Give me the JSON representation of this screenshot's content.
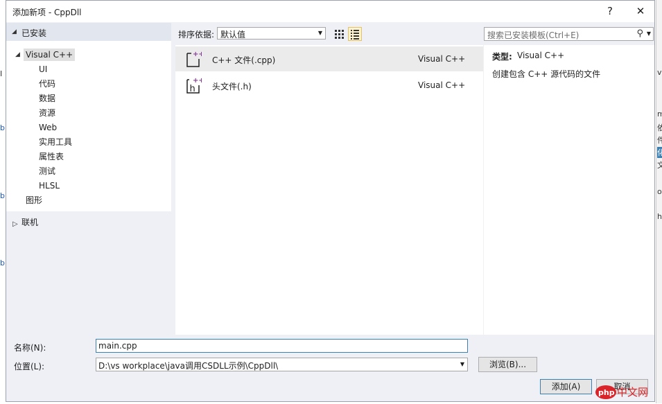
{
  "window": {
    "title": "添加新项 - CppDll",
    "help_label": "?",
    "close_label": "✕"
  },
  "left": {
    "installed_label": "已安装",
    "root_label": "Visual C++",
    "children": [
      "UI",
      "代码",
      "数据",
      "资源",
      "Web",
      "实用工具",
      "属性表",
      "测试",
      "HLSL"
    ],
    "graphics_label": "图形",
    "online_label": "联机"
  },
  "sort": {
    "label": "排序依据:",
    "value": "默认值"
  },
  "files": [
    {
      "name": "C++ 文件(.cpp)",
      "lang": "Visual C++",
      "icon": "cpp-file-icon",
      "selected": true
    },
    {
      "name": "头文件(.h)",
      "lang": "Visual C++",
      "icon": "header-file-icon",
      "selected": false
    }
  ],
  "search": {
    "placeholder": "搜索已安装模板(Ctrl+E)"
  },
  "details": {
    "type_label": "类型:",
    "type_value": "Visual C++",
    "description": "创建包含 C++ 源代码的文件"
  },
  "form": {
    "name_label": "名称(N):",
    "name_value": "main.cpp",
    "location_label": "位置(L):",
    "location_value": "D:\\vs workplace\\java调用CSDLL示例\\CppDll\\",
    "browse_label": "浏览(B)...",
    "add_label": "添加(A)",
    "cancel_label": "取消"
  },
  "watermark": {
    "text": "php 中文网"
  },
  "colors": {
    "accent": "#3c7fb1",
    "icon_purple": "#8a3d9b",
    "watermark_red": "#d9252a"
  }
}
